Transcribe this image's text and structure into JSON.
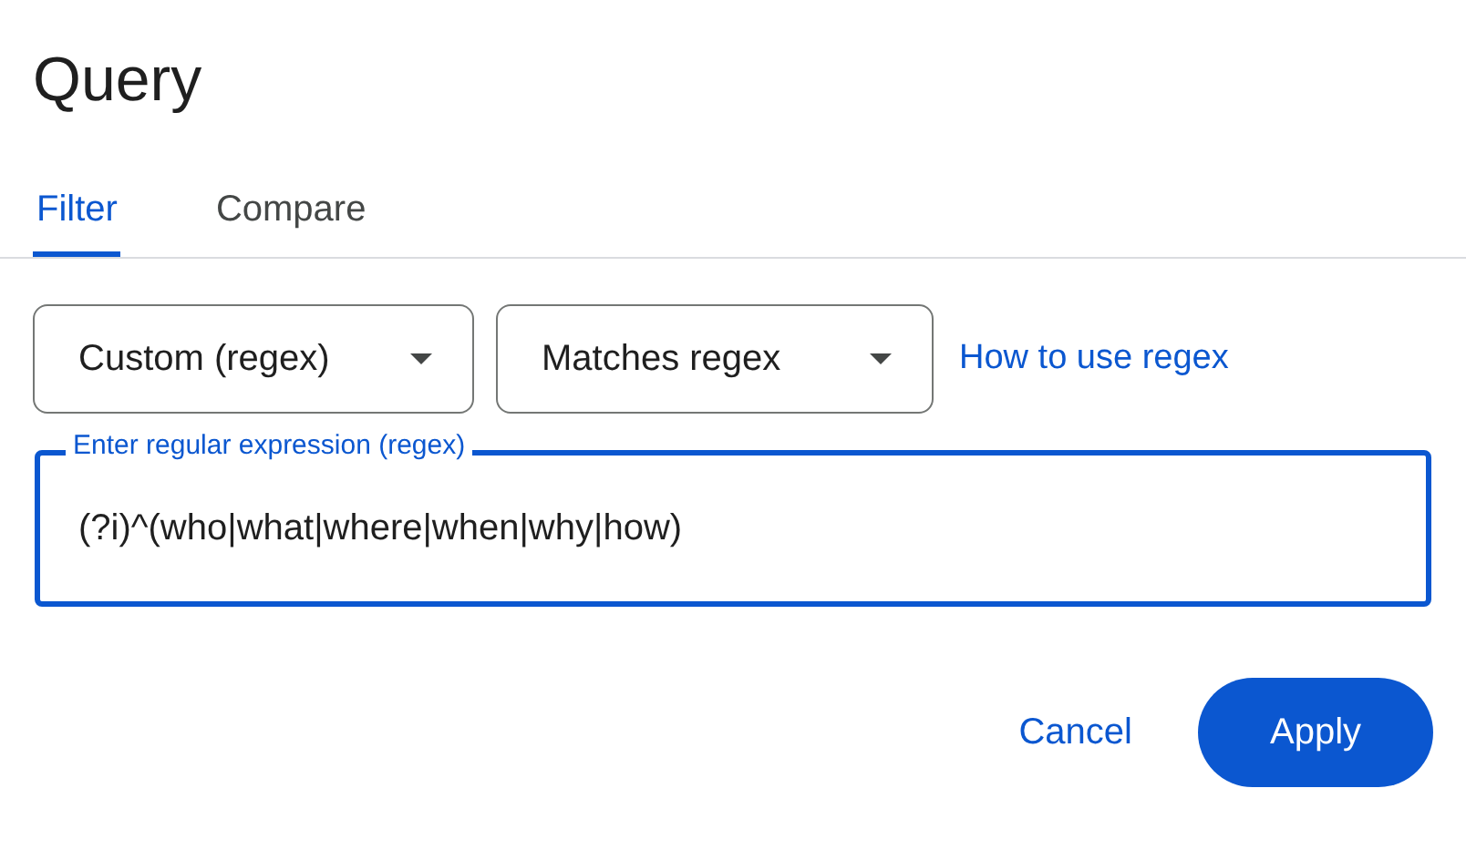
{
  "dialog": {
    "title": "Query"
  },
  "tabs": [
    {
      "label": "Filter",
      "selected": true
    },
    {
      "label": "Compare",
      "selected": false
    }
  ],
  "dropdowns": [
    {
      "value": "Custom (regex)"
    },
    {
      "value": "Matches regex"
    }
  ],
  "help_link": "How to use regex",
  "regex_field": {
    "label": "Enter regular expression (regex)",
    "value": "(?i)^(who|what|where|when|why|how)",
    "focused": true
  },
  "buttons": [
    {
      "label": "Cancel",
      "kind": "text"
    },
    {
      "label": "Apply",
      "kind": "filled"
    }
  ]
}
